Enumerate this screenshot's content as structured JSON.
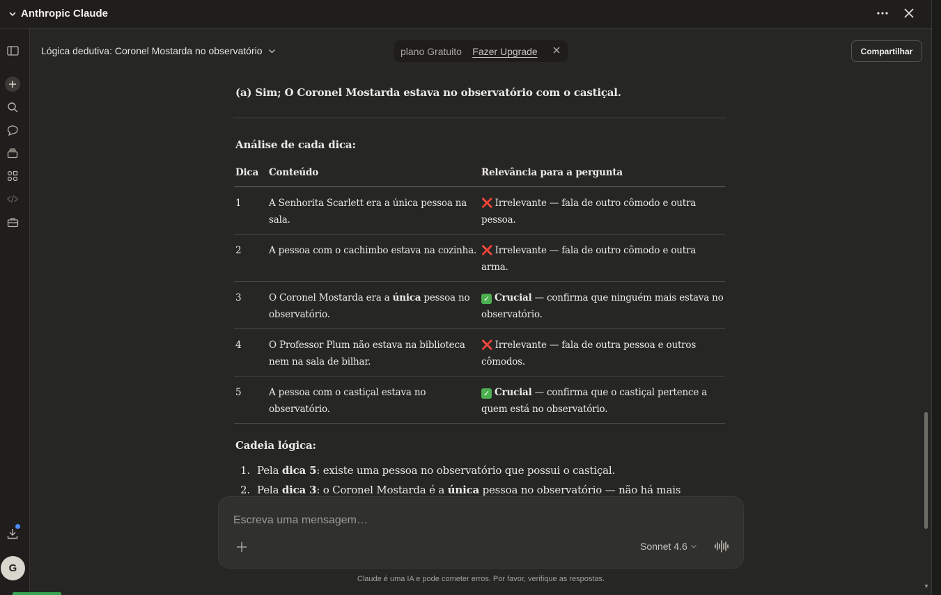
{
  "window": {
    "title": "Anthropic Claude",
    "menu_icon": "more-horizontal-icon",
    "close_icon": "close-icon"
  },
  "header": {
    "conversation_title": "Lógica dedutiva: Coronel Mostarda no observatório",
    "plan_label": "plano Gratuito",
    "plan_separator": "·",
    "upgrade_label": "Fazer Upgrade",
    "share_label": "Compartilhar"
  },
  "sidebar": {
    "avatar_initial": "G",
    "items": [
      "sidebar-toggle-icon",
      "new-chat-icon",
      "search-icon",
      "chats-icon",
      "projects-icon",
      "artifacts-icon",
      "code-icon",
      "toolbox-icon",
      "download-icon"
    ]
  },
  "content": {
    "answer": "(a) Sim; O Coronel Mostarda estava no observatório com o castiçal.",
    "analysis_heading": "Análise de cada dica:",
    "table": {
      "headers": [
        "Dica",
        "Conteúdo",
        "Relevância para a pergunta"
      ],
      "rows": [
        {
          "n": "1",
          "content": "A Senhorita Scarlett era a única pessoa na sala.",
          "mark": "❌",
          "status": "Irrelevante",
          "note": " — fala de outro cômodo e outra pessoa."
        },
        {
          "n": "2",
          "content": "A pessoa com o cachimbo estava na cozinha.",
          "mark": "❌",
          "status": "Irrelevante",
          "note": " — fala de outro cômodo e outra arma."
        },
        {
          "n": "3",
          "content_pre": "O Coronel Mostarda era a ",
          "content_bold": "única",
          "content_post": " pessoa no observatório.",
          "mark": "✓",
          "status": "Crucial",
          "note": " — confirma que ninguém mais estava no observatório."
        },
        {
          "n": "4",
          "content": "O Professor Plum não estava na biblioteca nem na sala de bilhar.",
          "mark": "❌",
          "status": "Irrelevante",
          "note": " — fala de outra pessoa e outros cômodos."
        },
        {
          "n": "5",
          "content": "A pessoa com o castiçal estava no observatório.",
          "mark": "✓",
          "status": "Crucial",
          "note": " — confirma que o castiçal pertence a quem está no observatório."
        }
      ]
    },
    "chain_heading": "Cadeia lógica:",
    "chain": [
      {
        "num": "1.",
        "pre": "Pela ",
        "bold": "dica 5",
        "post": ": existe uma pessoa no observatório que possui o castiçal."
      },
      {
        "num": "2.",
        "pre": "Pela ",
        "bold": "dica 3",
        "post": ": o Coronel Mostarda é a ",
        "bold2": "única",
        "post2": " pessoa no observatório — não há mais"
      }
    ]
  },
  "composer": {
    "placeholder": "Escreva uma mensagem…",
    "model": "Sonnet 4.6",
    "disclaimer": "Claude é uma IA e pode cometer erros. Por favor, verifique as respostas."
  },
  "colors": {
    "background": "#262624",
    "sidebar": "#1f1e1d",
    "irrelevant_mark": "#e2374b",
    "crucial_mark": "#4caf50",
    "notification_dot": "#4c8dff"
  }
}
